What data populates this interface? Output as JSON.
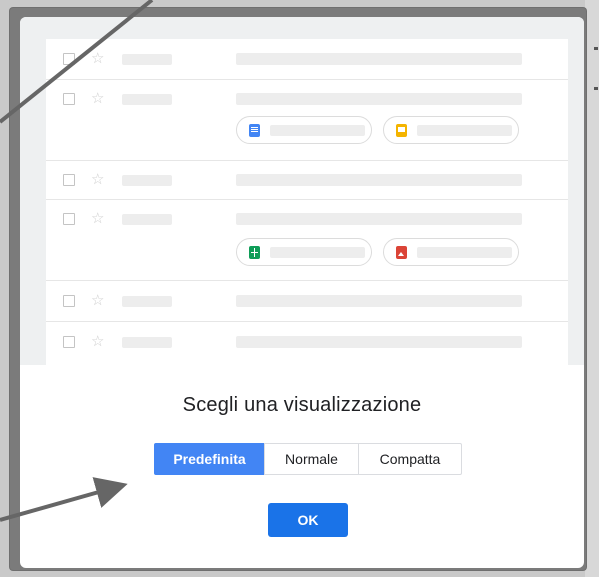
{
  "dialog": {
    "title": "Scegli una visualizzazione",
    "options": [
      {
        "label": "Predefinita",
        "selected": true
      },
      {
        "label": "Normale",
        "selected": false
      },
      {
        "label": "Compatta",
        "selected": false
      }
    ],
    "ok_label": "OK"
  },
  "preview": {
    "attachment_icons": [
      "docs-icon",
      "slides-icon",
      "sheets-icon",
      "image-icon"
    ]
  },
  "colors": {
    "accent": "#4285f4",
    "ok_button": "#1a73e8",
    "arrow": "#666666"
  }
}
